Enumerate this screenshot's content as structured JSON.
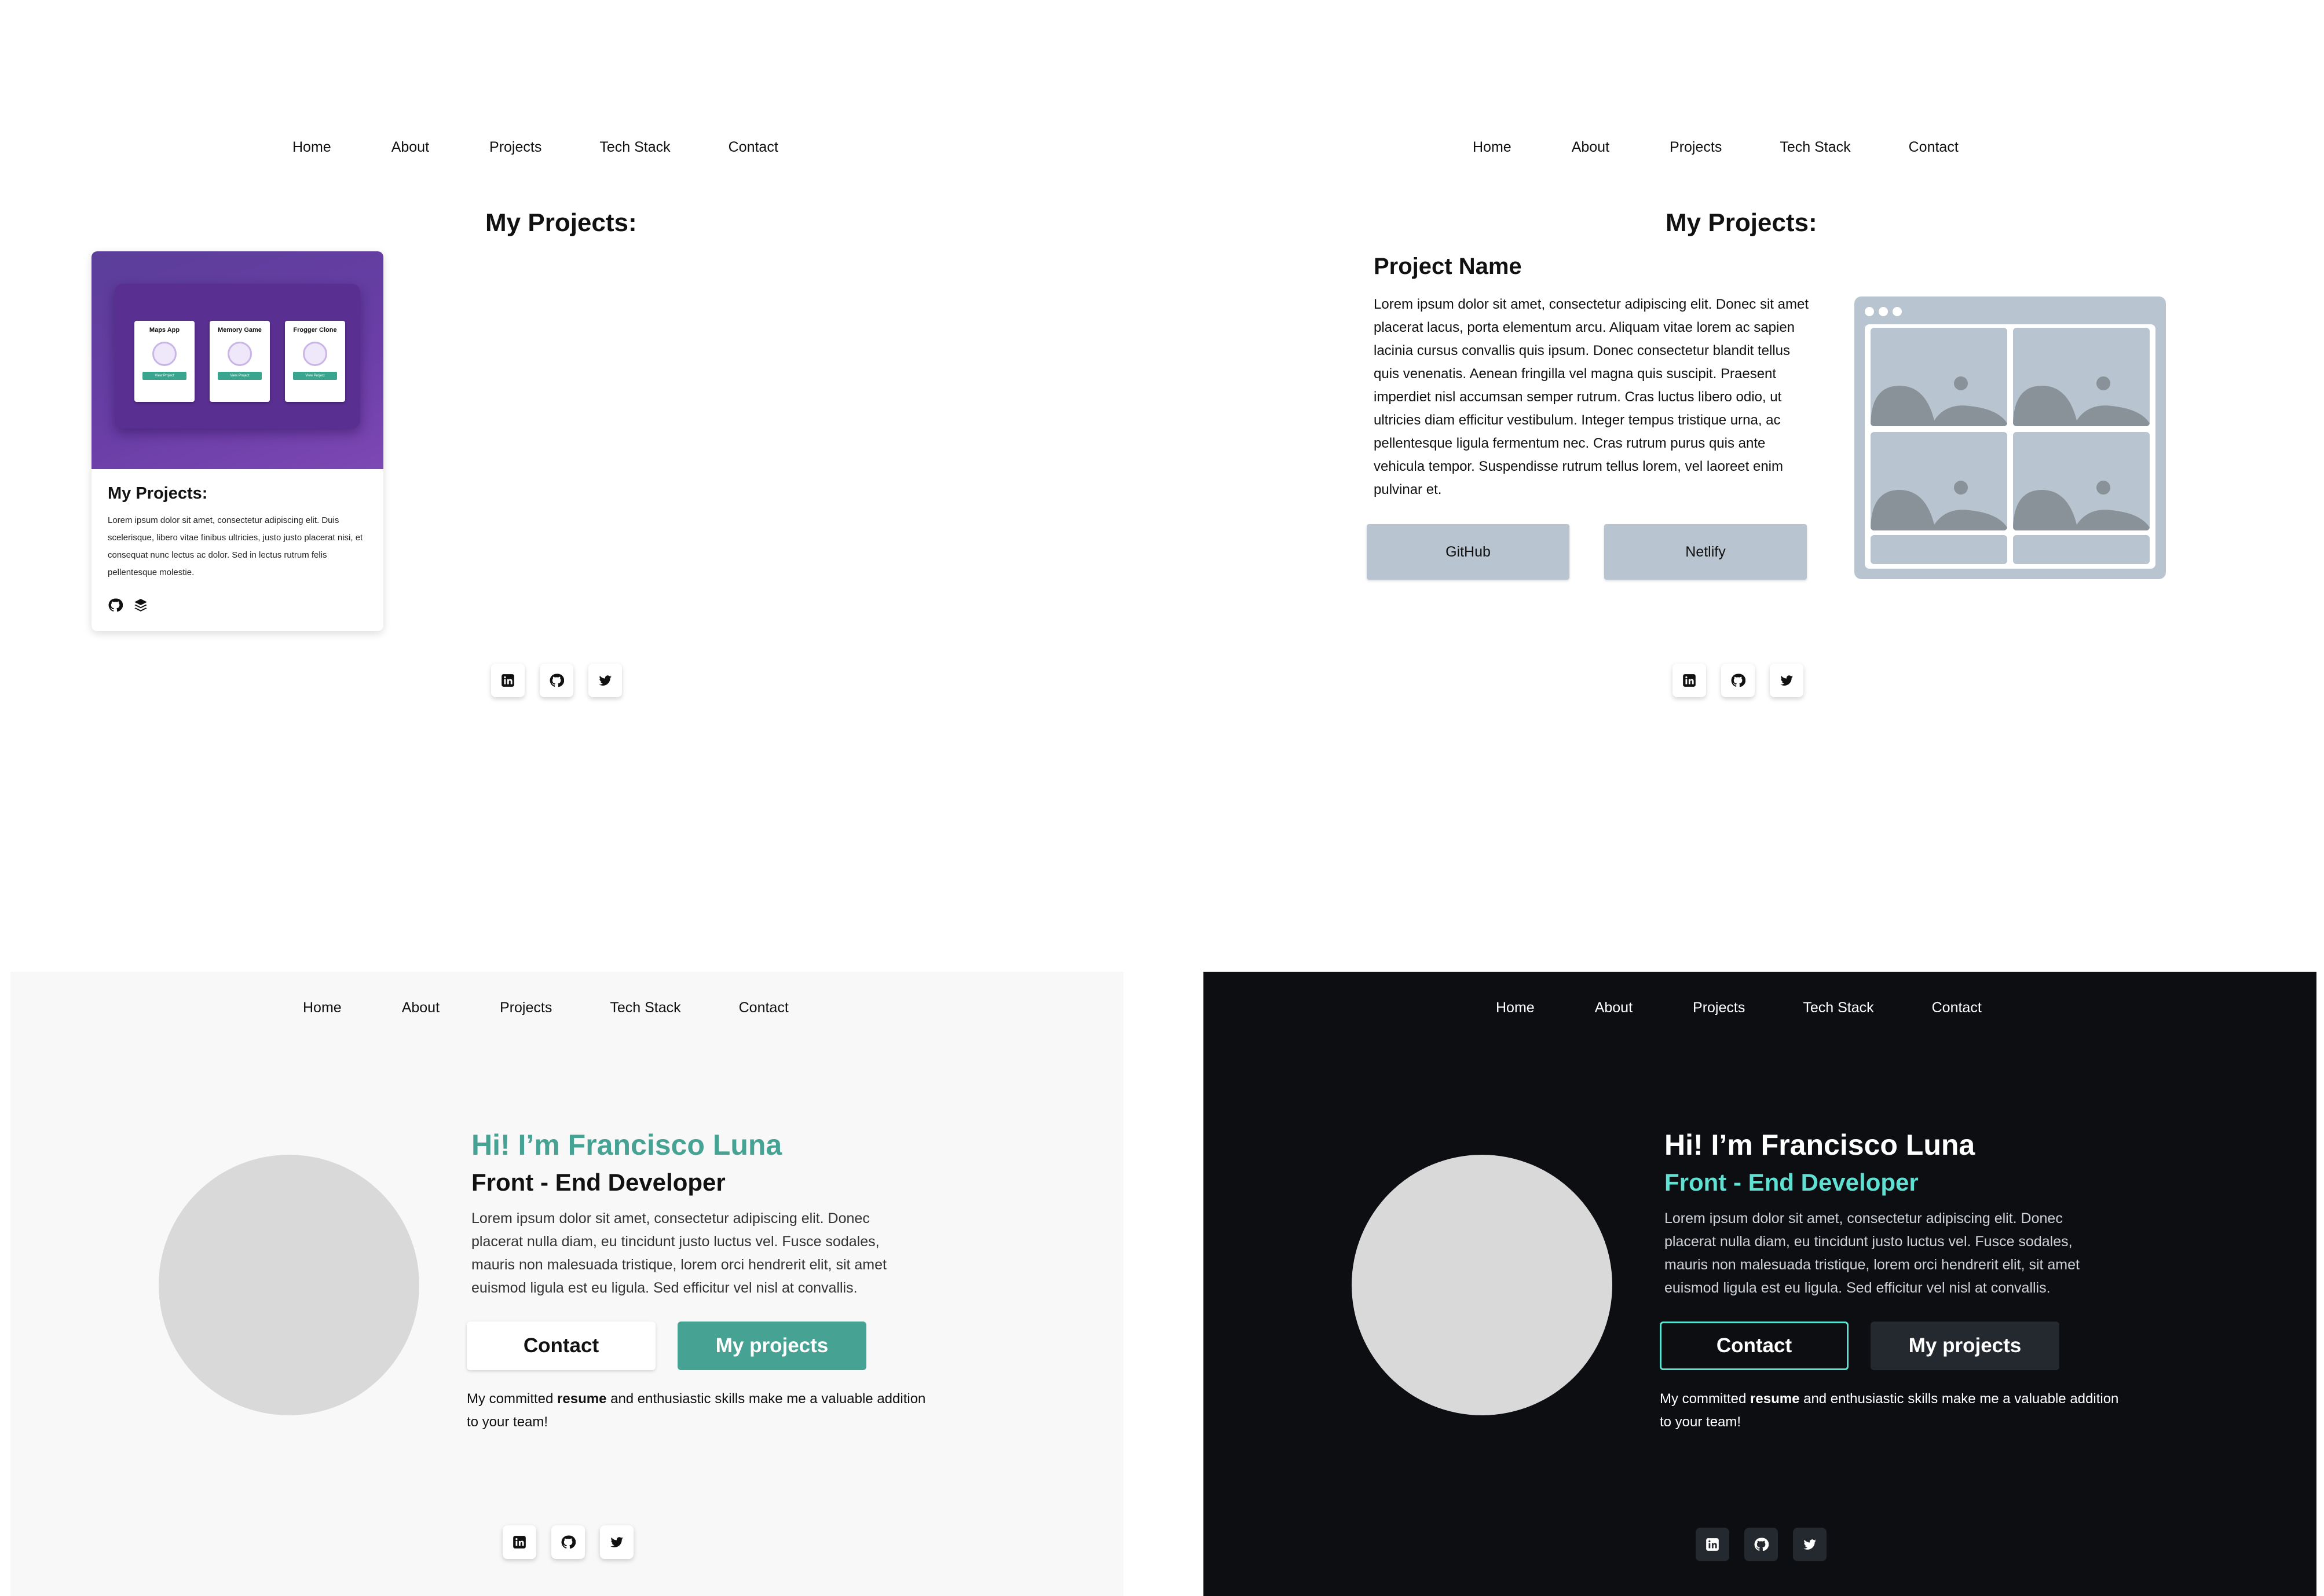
{
  "nav": {
    "home": "Home",
    "about": "About",
    "projects": "Projects",
    "tech_stack": "Tech Stack",
    "contact": "Contact"
  },
  "projects_page": {
    "title": "My Projects:",
    "card": {
      "title": "My Projects:",
      "description": "Lorem ipsum dolor sit amet, consectetur adipiscing elit. Duis scelerisque, libero vitae finibus ultricies, justo justo placerat nisi, et consequat nunc lectus ac dolor. Sed in lectus rutrum felis pellentesque molestie.",
      "mini_cards": [
        {
          "title": "Maps App",
          "button": "View Project"
        },
        {
          "title": "Memory Game",
          "button": "View Project"
        },
        {
          "title": "Frogger Clone",
          "button": "View Project"
        }
      ],
      "icons": [
        "github-icon",
        "stack-icon"
      ]
    }
  },
  "project_detail": {
    "title": "My Projects:",
    "name": "Project Name",
    "description": "Lorem ipsum dolor sit amet, consectetur adipiscing elit. Donec sit amet placerat lacus, porta elementum arcu. Aliquam vitae lorem ac sapien lacinia cursus convallis quis ipsum. Donec consectetur blandit tellus quis venenatis. Aenean fringilla vel magna quis suscipit. Praesent imperdiet nisl accumsan semper rutrum. Cras luctus libero odio, ut ultricies diam efficitur vestibulum. Integer tempus tristique urna, ac pellentesque ligula fermentum nec. Cras rutrum purus quis ante vehicula tempor. Suspendisse rutrum tellus lorem, vel laoreet enim pulvinar et.",
    "github_label": "GitHub",
    "netlify_label": "Netlify"
  },
  "home": {
    "greeting": "Hi! I’m Francisco Luna",
    "role": "Front - End Developer",
    "intro": "Lorem ipsum dolor sit amet, consectetur adipiscing elit. Donec placerat nulla diam, eu tincidunt justo luctus vel. Fusce sodales, mauris non malesuada tristique, lorem orci hendrerit elit, sit amet euismod ligula est eu ligula. Sed efficitur vel nisl at convallis.",
    "contact_label": "Contact",
    "projects_label": "My projects",
    "tagline_before": "My committed ",
    "tagline_bold": "resume",
    "tagline_after": " and enthusiastic skills make me a valuable addition to your team!"
  },
  "social_icons": [
    "linkedin-icon",
    "github-icon",
    "twitter-icon"
  ],
  "colors": {
    "accent_teal": "#46a393",
    "accent_cyan": "#5ee0d3",
    "wire_gray": "#b8c4cf",
    "dark_bg": "#0d0e12",
    "light_bg": "#f8f8f8",
    "card_purple": "#6a3ea6"
  }
}
